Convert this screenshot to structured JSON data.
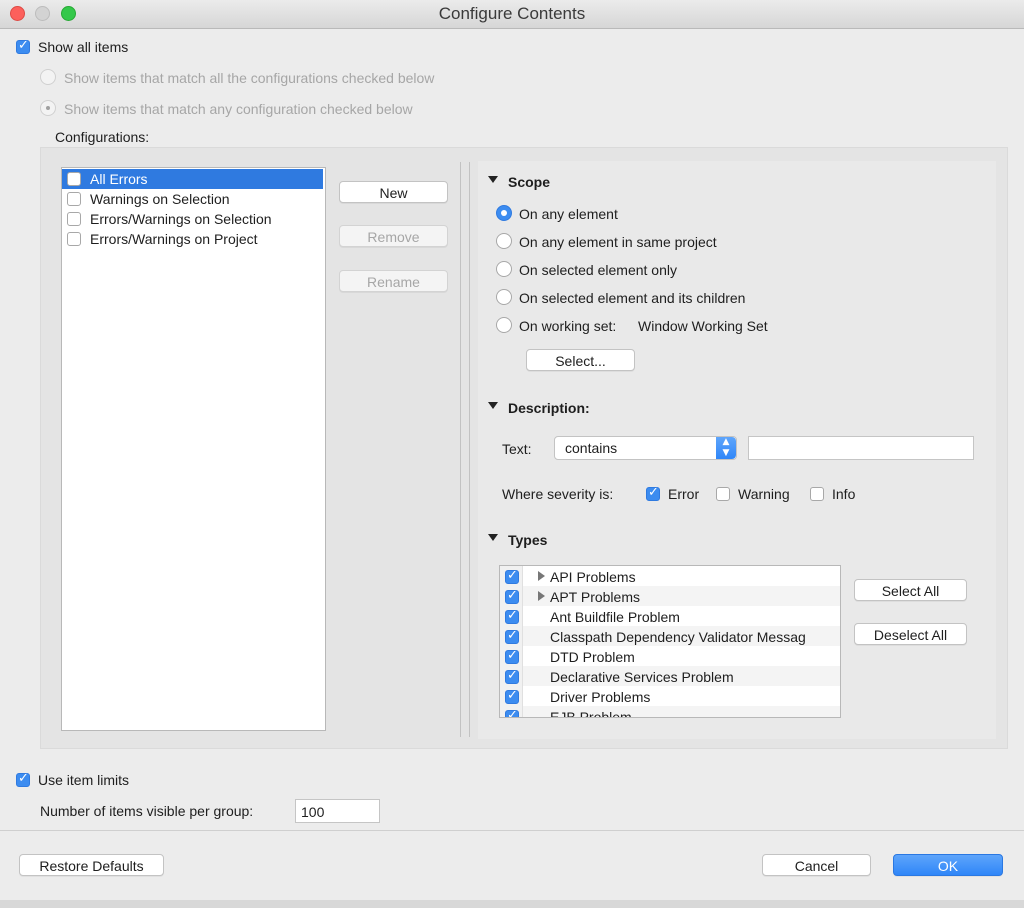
{
  "window": {
    "title": "Configure Contents"
  },
  "show_all": {
    "label": "Show all items",
    "checked": true
  },
  "match_mode": {
    "all_label": "Show items that match all the configurations checked below",
    "any_label": "Show items that match any configuration checked below"
  },
  "configurations": {
    "label": "Configurations:",
    "items": [
      {
        "label": "All Errors",
        "checked": false,
        "selected": true
      },
      {
        "label": "Warnings on Selection",
        "checked": false,
        "selected": false
      },
      {
        "label": "Errors/Warnings on Selection",
        "checked": false,
        "selected": false
      },
      {
        "label": "Errors/Warnings on Project",
        "checked": false,
        "selected": false
      }
    ],
    "new_label": "New",
    "remove_label": "Remove",
    "rename_label": "Rename"
  },
  "scope": {
    "title": "Scope",
    "options": [
      "On any element",
      "On any element in same project",
      "On selected element only",
      "On selected element and its children",
      "On working set:"
    ],
    "selected_index": 0,
    "working_set_name": "Window Working Set",
    "select_label": "Select..."
  },
  "description": {
    "title": "Description:",
    "text_label": "Text:",
    "mode_value": "contains",
    "text_value": "",
    "severity_label": "Where severity is:",
    "severities": [
      {
        "label": "Error",
        "checked": true
      },
      {
        "label": "Warning",
        "checked": false
      },
      {
        "label": "Info",
        "checked": false
      }
    ]
  },
  "types": {
    "title": "Types",
    "items": [
      {
        "label": "API Problems",
        "checked": true,
        "expandable": true
      },
      {
        "label": "APT Problems",
        "checked": true,
        "expandable": true
      },
      {
        "label": "Ant Buildfile Problem",
        "checked": true,
        "expandable": false
      },
      {
        "label": "Classpath Dependency Validator Messag",
        "checked": true,
        "expandable": false
      },
      {
        "label": "DTD Problem",
        "checked": true,
        "expandable": false
      },
      {
        "label": "Declarative Services Problem",
        "checked": true,
        "expandable": false
      },
      {
        "label": "Driver Problems",
        "checked": true,
        "expandable": false
      },
      {
        "label": "EJB Problem",
        "checked": true,
        "expandable": false
      }
    ],
    "select_all_label": "Select All",
    "deselect_all_label": "Deselect All"
  },
  "limits": {
    "label": "Use item limits",
    "checked": true,
    "count_label": "Number of items visible per group:",
    "count_value": "100"
  },
  "footer": {
    "restore_label": "Restore Defaults",
    "cancel_label": "Cancel",
    "ok_label": "OK"
  },
  "colors": {
    "accent": "#3c8cf0",
    "selection": "#2f7ae0"
  }
}
